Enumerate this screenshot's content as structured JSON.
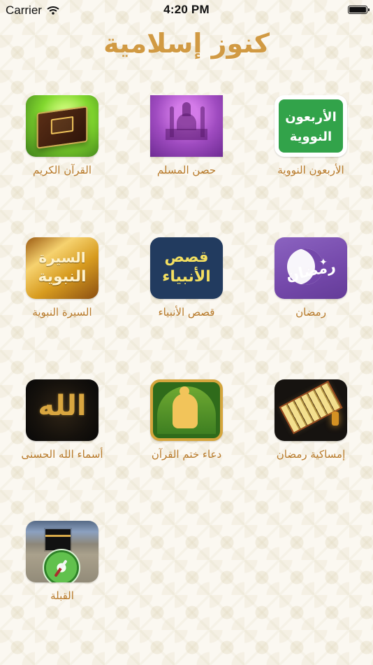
{
  "status_bar": {
    "carrier": "Carrier",
    "time": "4:20 PM",
    "icons": {
      "wifi": "wifi-icon",
      "battery": "battery-icon"
    }
  },
  "page": {
    "title": "كنوز إسلامية",
    "accent_color": "#d19a43",
    "label_color": "#b87a2a"
  },
  "grid": [
    {
      "key": "nawawi",
      "label": "الأربعون النووية",
      "icon_name": "forty-hadith-icon",
      "art_text": [
        "الأربعون",
        "النووية"
      ]
    },
    {
      "key": "hisn",
      "label": "حصن المسلم",
      "icon_name": "fortress-of-the-muslim-icon"
    },
    {
      "key": "quran",
      "label": "القرآن الكريم",
      "icon_name": "holy-quran-icon"
    },
    {
      "key": "ramadan",
      "label": "رمضان",
      "icon_name": "ramadan-icon",
      "art_text": "رمضان"
    },
    {
      "key": "prophets",
      "label": "قصص الأنبياء",
      "icon_name": "stories-of-prophets-icon",
      "art_text": [
        "قصص",
        "الأنبياء"
      ]
    },
    {
      "key": "sirah",
      "label": "السيرة النبوية",
      "icon_name": "prophetic-biography-icon",
      "art_text": [
        "السيرة",
        "النبوية"
      ]
    },
    {
      "key": "imsakia",
      "label": "إمساكية رمضان",
      "icon_name": "ramadan-imsakia-icon"
    },
    {
      "key": "khatm",
      "label": "دعاء ختم القرآن",
      "icon_name": "khatm-quran-dua-icon"
    },
    {
      "key": "asma",
      "label": "أسماء الله الحسنى",
      "icon_name": "names-of-allah-icon",
      "art_text": "الله"
    },
    {
      "key": "qibla",
      "label": "القبلة",
      "icon_name": "qibla-compass-icon"
    }
  ]
}
